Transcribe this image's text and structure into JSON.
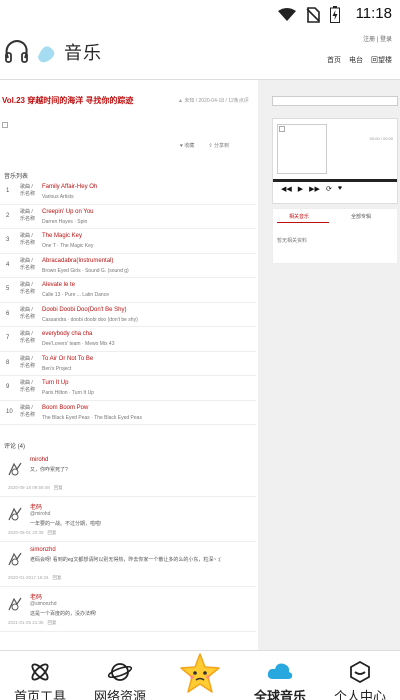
{
  "status_bar": {
    "time": "11:18"
  },
  "header": {
    "logo_text": "音乐",
    "top_links": "注册 | 登录",
    "nav": [
      "首页",
      "电台",
      "回望楼"
    ]
  },
  "post": {
    "title": "Vol.23 穿越时间的海洋 寻找你的踪迹",
    "meta": "▲ 未知 / 2020-04-18 / 12条点评",
    "like": "♥ 收藏",
    "share": "⇪ 分享到"
  },
  "playlist": {
    "title": "音乐列表",
    "thumb_label": "歌曲 / 乐名称",
    "songs": [
      {
        "num": "1",
        "name": "Family Affair-Hey Oh",
        "artist": "Various Artists"
      },
      {
        "num": "2",
        "name": "Creepin' Up on You",
        "artist": "Darren Hayes · Spin"
      },
      {
        "num": "3",
        "name": "The Magic Key",
        "artist": "One T · The Magic Key"
      },
      {
        "num": "4",
        "name": "Abracadabra(Instrumental)",
        "artist": "Brown Eyed Girls · Sound G. (sound g)"
      },
      {
        "num": "5",
        "name": "Alevate le te",
        "artist": "Calle 13 · Pure ... Latin Dance"
      },
      {
        "num": "6",
        "name": "Doobi Doobi Doo(Don't Be Shy)",
        "artist": "Cassandra · doobi doobi doo (don't be shy)"
      },
      {
        "num": "7",
        "name": "everybody cha cha",
        "artist": "Dee'Lovers' team · Mewo Mix 43"
      },
      {
        "num": "8",
        "name": "To Air Or Not To Be",
        "artist": "Ben's Project"
      },
      {
        "num": "9",
        "name": "Turn It Up",
        "artist": "Paris Hilton · Turn It Up"
      },
      {
        "num": "10",
        "name": "Boom Boom Pow",
        "artist": "The Black Eyed Peas · The Black Eyed Peas"
      }
    ]
  },
  "comments": {
    "header": "评论 (4)",
    "items": [
      {
        "user": "mirohd",
        "text": "又，你咋累死了?",
        "quote": "",
        "time": "2020-05-18 09:59:48",
        "reply": "回复"
      },
      {
        "user": "老码",
        "quote": "@mirohd",
        "text": "一年要的一战。不过分期，啦啦!",
        "time": "2020-05-01 20:39",
        "reply": "回复"
      },
      {
        "user": "simonzhd",
        "text": "老码会呀! 看到的eg文都想请阿以别无得热，昨去你家一个散让多的么的小东，粒深~ :(",
        "quote": "",
        "time": "2020-01-2017 16:34",
        "reply": "回复"
      },
      {
        "user": "老码",
        "quote": "@simonzhd",
        "text": "这是一个百度的的，没办法啊!",
        "time": "2021-01-25 21:35",
        "reply": "回复"
      }
    ]
  },
  "sidebar": {
    "player_time": "00:00 / 00:00",
    "tabs": [
      "相关音乐",
      "全部专辑"
    ],
    "text": "暂无相关资料"
  },
  "bottom_nav": {
    "items": [
      {
        "label": "首页工具"
      },
      {
        "label": "网络资源"
      },
      {
        "label": "全球音乐"
      },
      {
        "label": "个人中心"
      }
    ]
  }
}
